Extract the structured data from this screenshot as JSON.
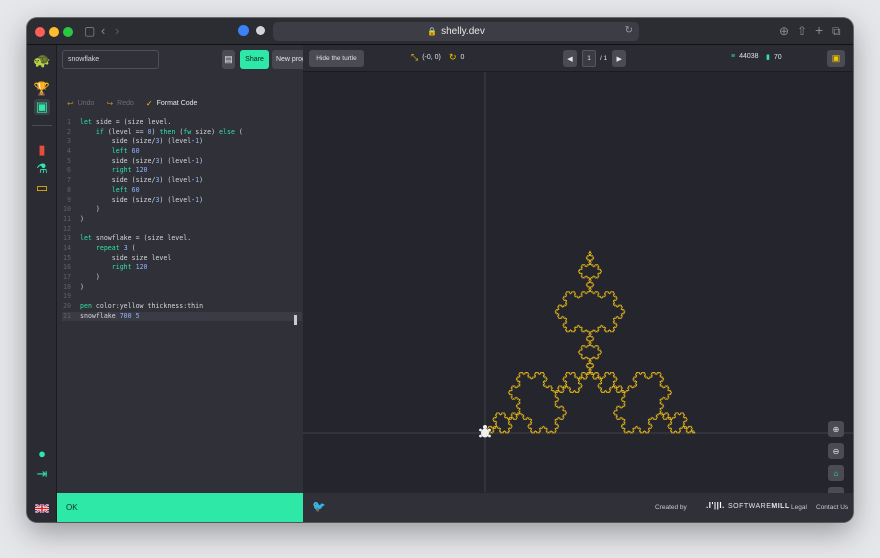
{
  "browser": {
    "url": "shelly.dev",
    "traffic_colors": [
      "#ff5f57",
      "#febc2e",
      "#28c840"
    ]
  },
  "rail": {
    "icons": [
      "turtle-logo-icon",
      "trophy-icon",
      "gallery-icon",
      "book-icon",
      "flask-icon",
      "bus-icon",
      "user-settings-icon",
      "logout-icon",
      "flag-uk-icon"
    ]
  },
  "editor": {
    "program_name": "snowflake",
    "share_label": "Share",
    "new_program_label": "New program",
    "undo_label": "Undo",
    "redo_label": "Redo",
    "format_label": "Format Code",
    "status": "OK",
    "lines": [
      "let side = (size level.",
      "    if (level == 0) then (fw size) else (",
      "        side (size/3) (level-1)",
      "        left 60",
      "        side (size/3) (level-1)",
      "        right 120",
      "        side (size/3) (level-1)",
      "        left 60",
      "        side (size/3) (level-1)",
      "    )",
      ")",
      "",
      "let snowflake = (size level.",
      "    repeat 3 (",
      "        side size level",
      "        right 120",
      "    )",
      ")",
      "",
      "pen color:yellow thickness:thin",
      "snowflake 700 5"
    ]
  },
  "canvas": {
    "hide_turtle_label": "Hide the turtle",
    "position": "(-0, 0)",
    "angle": "0",
    "page_current": "1",
    "page_total": "/ 1",
    "stat_lines": "44038",
    "stat_commands": "70",
    "snowflake_size": 700,
    "snowflake_level": 5,
    "pen_color": "#e8b91b"
  },
  "footer": {
    "created_by": "Created by",
    "company_logo": ".I'||I.",
    "company_name_a": "SOFTWARE",
    "company_name_b": "MILL",
    "legal": "Legal",
    "contact": "Contact Us"
  },
  "colors": {
    "accent": "#2ee8a7",
    "background": "#24252d",
    "panel": "#2f3038"
  }
}
